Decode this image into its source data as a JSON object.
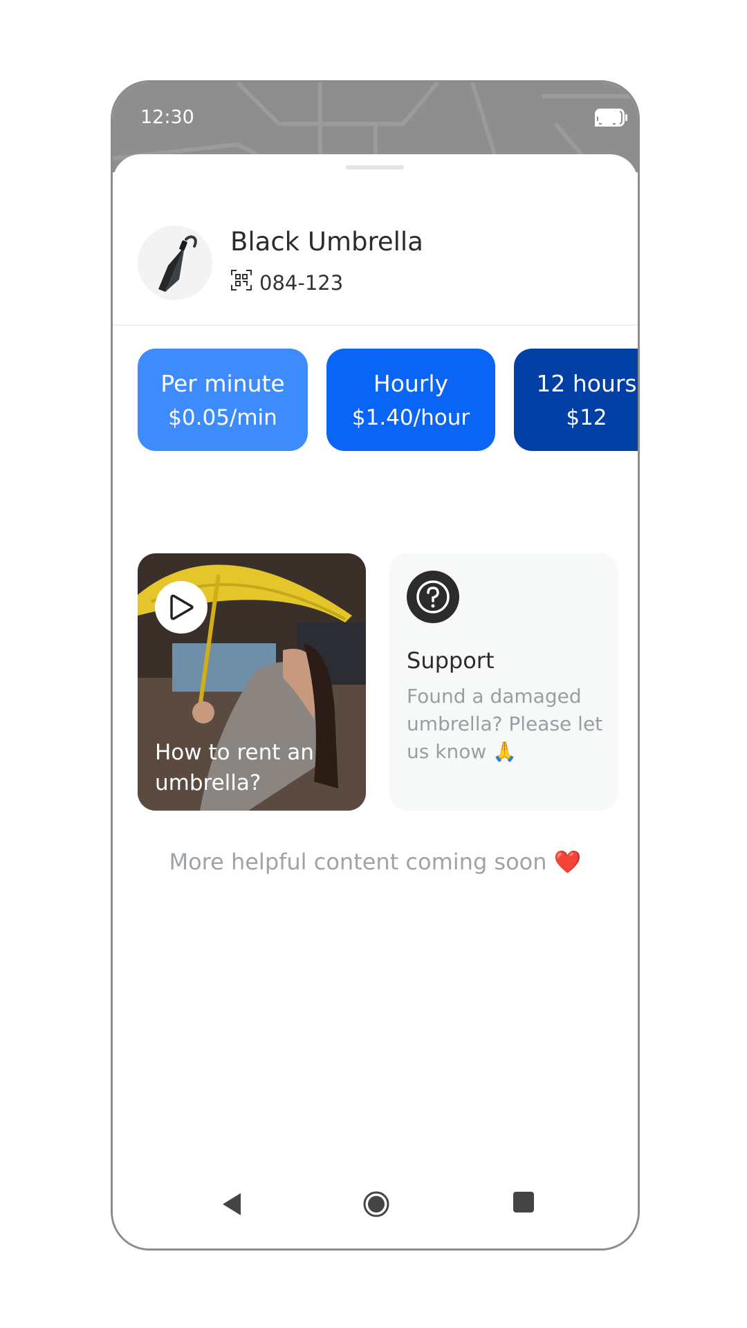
{
  "status_bar": {
    "time": "12:30",
    "icons": [
      "signal-icon",
      "wifi-icon",
      "battery-icon"
    ]
  },
  "product": {
    "icon": "umbrella-icon",
    "name": "Black Umbrella",
    "code_icon": "qr-code-icon",
    "code": "084-123"
  },
  "rates": [
    {
      "name": "Per minute",
      "price": "$0.05/min",
      "color": "#3d8bfd"
    },
    {
      "name": "Hourly",
      "price": "$1.40/hour",
      "color": "#0a64f5"
    },
    {
      "name": "12 hours",
      "price": "$12",
      "color": "#0340a6"
    }
  ],
  "video_card": {
    "icon": "play-icon",
    "caption": "How to rent an umbrella?"
  },
  "support_card": {
    "icon": "question-icon",
    "title": "Support",
    "description": "Found a damaged umbrella? Please let us know 🙏"
  },
  "footer_note": "More helpful content coming soon ❤️",
  "nav": [
    "back-icon",
    "home-icon",
    "recents-icon"
  ],
  "colors": {
    "primary_text": "#2b2b2b",
    "muted_text": "#9ea3a8",
    "card_bg": "#f7f8f8"
  }
}
